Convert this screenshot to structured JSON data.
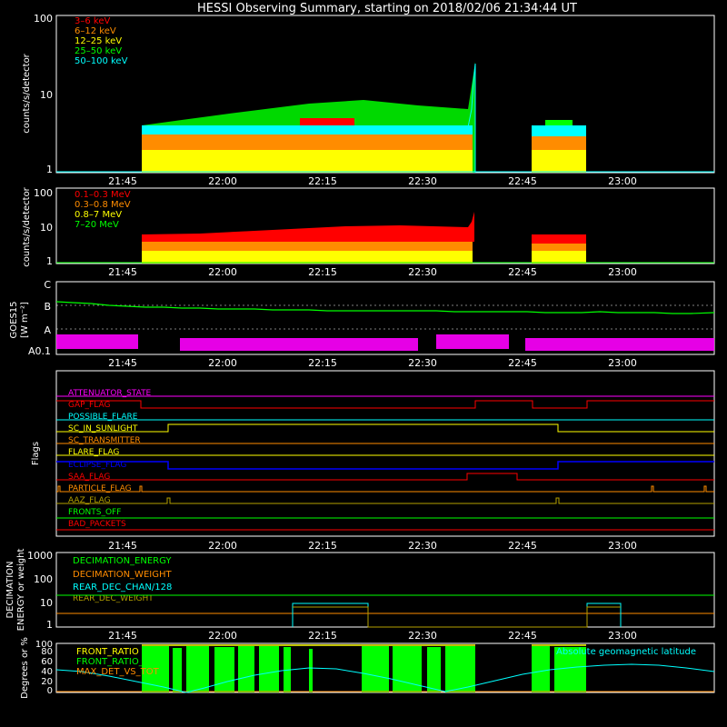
{
  "title": "HESSI Observing Summary, starting on 2018/02/06 21:34:44 UT",
  "time_axis": {
    "start": "21:34:44",
    "end": "23:13:00",
    "tick_labels": [
      "21:45",
      "22:00",
      "22:15",
      "22:30",
      "22:45",
      "23:00"
    ]
  },
  "colors": {
    "red": "#ff0000",
    "orange": "#ff8c00",
    "yellow": "#ffff00",
    "green": "#00ff00",
    "cyan": "#00ffff",
    "magenta": "#ff00ff",
    "blue": "#0000ff",
    "olive": "#b4a000"
  },
  "panels": {
    "rates_lo": {
      "ylabel": "counts/s/detector",
      "tick_labels": [
        "1",
        "10",
        "100"
      ],
      "legend": [
        {
          "label": "3–6 keV",
          "color": "red"
        },
        {
          "label": "6–12 keV",
          "color": "orange"
        },
        {
          "label": "12–25 keV",
          "color": "yellow"
        },
        {
          "label": "25–50 keV",
          "color": "green"
        },
        {
          "label": "50–100 keV",
          "color": "cyan"
        }
      ]
    },
    "rates_hi": {
      "ylabel": "counts/s/detector",
      "tick_labels": [
        "1",
        "10",
        "100"
      ],
      "legend": [
        {
          "label": "0.1–0.3 MeV",
          "color": "red"
        },
        {
          "label": "0.3–0.8 MeV",
          "color": "orange"
        },
        {
          "label": "0.8–7 MeV",
          "color": "yellow"
        },
        {
          "label": "7–20 MeV",
          "color": "green"
        }
      ]
    },
    "goes": {
      "ylabel_line1": "GOES15",
      "ylabel_line2": "[W m⁻²]",
      "tick_labels": [
        "C",
        "B",
        "A",
        "A0.1"
      ]
    },
    "flags": {
      "ylabel": "Flags",
      "rows": [
        {
          "label": "ATTENUATOR_STATE",
          "color": "magenta"
        },
        {
          "label": "GAP_FLAG",
          "color": "red"
        },
        {
          "label": "POSSIBLE_FLARE",
          "color": "cyan"
        },
        {
          "label": "SC_IN_SUNLIGHT",
          "color": "yellow"
        },
        {
          "label": "SC_TRANSMITTER",
          "color": "orange"
        },
        {
          "label": "FLARE_FLAG",
          "color": "yellow"
        },
        {
          "label": "ECLIPSE_FLAG",
          "color": "blue"
        },
        {
          "label": "SAA_FLAG",
          "color": "red"
        },
        {
          "label": "PARTICLE_FLAG",
          "color": "orange"
        },
        {
          "label": "AAZ_FLAG",
          "color": "olive"
        },
        {
          "label": "FRONTS_OFF",
          "color": "green"
        },
        {
          "label": "BAD_PACKETS",
          "color": "red"
        }
      ]
    },
    "decimation": {
      "ylabel_line1": "DECIMATION",
      "ylabel_line2": "ENERGY or weight",
      "tick_labels": [
        "1",
        "10",
        "100",
        "1000"
      ],
      "legend": [
        {
          "label": "DECIMATION_ENERGY",
          "color": "green"
        },
        {
          "label": "DECIMATION_WEIGHT",
          "color": "orange"
        },
        {
          "label": "REAR_DEC_CHAN/128",
          "color": "cyan"
        },
        {
          "label": "REAR_DEC_WEIGHT",
          "color": "olive"
        }
      ]
    },
    "ratios": {
      "ylabel": "Degrees or %",
      "tick_labels": [
        "0",
        "20",
        "40",
        "60",
        "80",
        "100"
      ],
      "legend": [
        {
          "label": "FRONT_RATIO",
          "color": "yellow"
        },
        {
          "label": "FRONT_RATIO_1225",
          "color": "green"
        },
        {
          "label": "MAX_DET_VS_TOT",
          "color": "orange"
        }
      ],
      "right_legend": {
        "label": "Absolute geomagnetic latitude",
        "color": "cyan"
      }
    }
  },
  "chart_data": [
    {
      "type": "line",
      "title": "HESSI Observing Summary, starting on 2018/02/06 21:34:44 UT",
      "ylabel": "counts/s/detector",
      "yscale": "log",
      "ylim": [
        1,
        100
      ],
      "x_unit": "UT",
      "xlim": [
        "21:34:44",
        "23:13:00"
      ],
      "series": [
        {
          "name": "3–6 keV",
          "x": [
            "21:48",
            "22:00",
            "22:15",
            "22:30",
            "22:36",
            "22:37"
          ],
          "values": [
            3,
            3.2,
            3.5,
            4,
            4.5,
            20
          ]
        },
        {
          "name": "6–12 keV",
          "x": [
            "21:48",
            "22:00",
            "22:15",
            "22:30",
            "22:36",
            "22:37"
          ],
          "values": [
            2,
            2.5,
            3,
            3,
            3.5,
            15
          ]
        },
        {
          "name": "12–25 keV",
          "x": [
            "21:48",
            "22:00",
            "22:15",
            "22:30",
            "22:36",
            "22:37"
          ],
          "values": [
            1.5,
            1.8,
            2,
            2,
            2,
            10
          ]
        },
        {
          "name": "25–50 keV",
          "x": [
            "21:48",
            "22:00",
            "22:15",
            "22:30",
            "22:36",
            "22:37"
          ],
          "values": [
            4,
            5,
            6.5,
            6,
            8,
            25
          ]
        },
        {
          "name": "50–100 keV",
          "x": [
            "21:48",
            "22:00",
            "22:15",
            "22:30",
            "22:36",
            "22:37"
          ],
          "values": [
            3.5,
            4,
            5,
            5,
            5,
            10
          ]
        }
      ],
      "observation_intervals": [
        [
          "21:48:30",
          "22:37:20"
        ],
        [
          "22:48:30",
          "22:56:50"
        ]
      ]
    },
    {
      "type": "line",
      "ylabel": "counts/s/detector",
      "yscale": "log",
      "ylim": [
        1,
        100
      ],
      "series": [
        {
          "name": "0.1–0.3 MeV",
          "x": [
            "21:48",
            "22:00",
            "22:15",
            "22:30",
            "22:36",
            "22:37"
          ],
          "values": [
            5.5,
            6.5,
            8,
            9,
            10,
            22
          ]
        },
        {
          "name": "0.3–0.8 MeV",
          "x": [
            "21:48",
            "22:00",
            "22:15",
            "22:30",
            "22:36",
            "22:37"
          ],
          "values": [
            3,
            3.5,
            4,
            5,
            5,
            10
          ]
        },
        {
          "name": "0.8–7 MeV",
          "x": [
            "21:48",
            "22:00",
            "22:15",
            "22:30",
            "22:36",
            "22:37"
          ],
          "values": [
            2,
            2.2,
            2.5,
            3,
            3,
            5
          ]
        },
        {
          "name": "7–20 MeV",
          "x": [
            "21:48",
            "22:00",
            "22:15",
            "22:30",
            "22:36",
            "22:37"
          ],
          "values": [
            1,
            1,
            1,
            1,
            1,
            1
          ]
        }
      ]
    },
    {
      "type": "line",
      "ylabel": "GOES15 [W m⁻²]",
      "yscale": "log",
      "tick_labels": [
        "C",
        "B",
        "A",
        "A0.1"
      ],
      "series": [
        {
          "name": "long channel",
          "x": [
            "21:34:44",
            "21:50",
            "22:15",
            "22:45",
            "23:13"
          ],
          "values": [
            1.2e-07,
            1e-07,
            9e-08,
            8e-08,
            7.5e-08
          ]
        },
        {
          "name": "short channel",
          "x": [
            "21:34:44",
            "22:15",
            "23:13"
          ],
          "values": [
            1.5e-09,
            1.5e-09,
            1.5e-09
          ]
        }
      ]
    },
    {
      "type": "line",
      "ylabel": "Flags",
      "series": [
        {
          "name": "GAP_FLAG",
          "x": [
            "21:34:44",
            "21:48:30",
            "22:38",
            "22:47",
            "22:56",
            "23:13"
          ],
          "values": [
            1,
            0,
            1,
            0,
            1,
            1
          ]
        },
        {
          "name": "SC_IN_SUNLIGHT",
          "x": [
            "21:34:44",
            "21:52",
            "22:51",
            "23:13"
          ],
          "values": [
            0,
            1,
            0,
            0
          ]
        },
        {
          "name": "ECLIPSE_FLAG",
          "x": [
            "21:34:44",
            "21:52",
            "22:51",
            "23:13"
          ],
          "values": [
            1,
            0,
            1,
            1
          ]
        },
        {
          "name": "SAA_FLAG",
          "x": [
            "21:34:44",
            "22:36",
            "22:44",
            "23:13"
          ],
          "values": [
            0,
            1,
            0,
            0
          ]
        },
        {
          "name": "PARTICLE_FLAG",
          "x": [
            "21:35",
            "21:48",
            "23:06",
            "23:12"
          ],
          "values": [
            1,
            1,
            1,
            1
          ]
        },
        {
          "name": "AAZ_FLAG",
          "x": [
            "21:51",
            "22:51"
          ],
          "values": [
            1,
            1
          ]
        }
      ]
    },
    {
      "type": "line",
      "ylabel": "DECIMATION ENERGY or weight",
      "yscale": "log",
      "ylim": [
        1,
        1000
      ],
      "series": [
        {
          "name": "DECIMATION_ENERGY",
          "x": [
            "21:34:44",
            "23:13"
          ],
          "values": [
            20,
            20
          ]
        },
        {
          "name": "DECIMATION_WEIGHT",
          "x": [
            "21:34:44",
            "22:45",
            "23:13"
          ],
          "values": [
            4,
            4,
            4
          ]
        },
        {
          "name": "REAR_DEC_CHAN/128",
          "x": [
            "22:11",
            "22:22:30",
            "22:56",
            "23:00"
          ],
          "values": [
            8,
            8,
            8,
            8
          ]
        },
        {
          "name": "REAR_DEC_WEIGHT",
          "x": [
            "22:11",
            "22:22:30",
            "22:56",
            "23:00"
          ],
          "values": [
            6,
            6,
            6,
            6
          ]
        }
      ]
    },
    {
      "type": "line",
      "ylabel": "Degrees or %",
      "ylim": [
        0,
        100
      ],
      "series": [
        {
          "name": "FRONT_RATIO",
          "x": [
            "21:48",
            "22:00",
            "22:15",
            "22:30",
            "22:37"
          ],
          "values": [
            98,
            98,
            99,
            98,
            97
          ]
        },
        {
          "name": "FRONT_RATIO_1225",
          "x": [
            "21:48",
            "22:00",
            "22:15",
            "22:30",
            "22:37"
          ],
          "values": [
            90,
            95,
            95,
            95,
            92
          ]
        },
        {
          "name": "MAX_DET_VS_TOT",
          "x": [
            "21:48",
            "22:37"
          ],
          "values": [
            0,
            0
          ]
        },
        {
          "name": "Absolute geomagnetic latitude",
          "x": [
            "21:34:44",
            "21:55",
            "22:15",
            "22:38",
            "23:00",
            "23:13"
          ],
          "values": [
            33,
            0,
            35,
            2,
            36,
            33
          ]
        }
      ]
    }
  ]
}
